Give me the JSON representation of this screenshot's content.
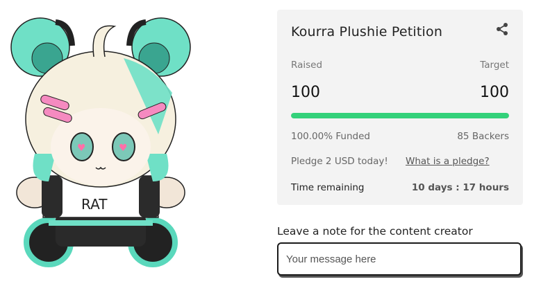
{
  "product_image": {
    "shirt_text": "RAT"
  },
  "campaign": {
    "title": "Kourra Plushie Petition",
    "raised_label": "Raised",
    "target_label": "Target",
    "raised_value": "100",
    "target_value": "100",
    "progress_fraction": 1.0,
    "funded_text": "100.00% Funded",
    "backers_text": "85 Backers",
    "pledge_text": "Pledge 2 USD today!",
    "pledge_link": "What is a pledge?",
    "time_label": "Time remaining",
    "time_value": "10 days : 17 hours",
    "share_icon": "share-icon"
  },
  "note": {
    "label": "Leave a note for the content creator",
    "placeholder": "Your message here"
  },
  "colors": {
    "card_bg": "#f3f3f3",
    "progress": "#33d17a",
    "mint": "#66e0c4",
    "hair": "#f6f0df"
  }
}
